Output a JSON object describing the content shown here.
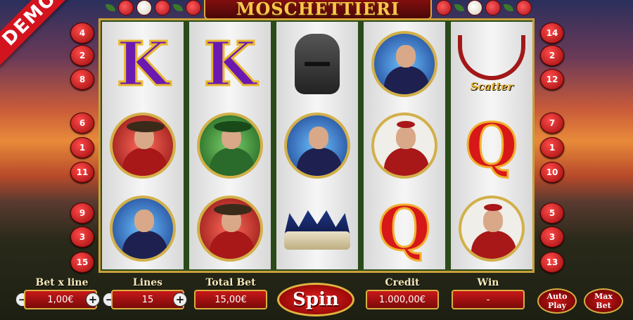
{
  "demo_label": "DEMO",
  "title": "MOSCHETTIERI",
  "left_line_numbers": [
    "4",
    "2",
    "8",
    "6",
    "1",
    "11",
    "9",
    "3",
    "15"
  ],
  "right_line_numbers": [
    "14",
    "2",
    "12",
    "7",
    "1",
    "10",
    "5",
    "3",
    "13"
  ],
  "scatter_label": "Scatter",
  "controls": {
    "bet_label": "Bet x line",
    "bet_value": "1,00€",
    "lines_label": "Lines",
    "lines_value": "15",
    "total_label": "Total Bet",
    "total_value": "15,00€",
    "spin_label": "Spin",
    "credit_label": "Credit",
    "credit_value": "1.000,00€",
    "win_label": "Win",
    "win_value": "-",
    "auto_label_1": "Auto",
    "auto_label_2": "Play",
    "max_label_1": "Max",
    "max_label_2": "Bet",
    "minus": "−",
    "plus": "+"
  },
  "reels": [
    [
      "king-symbol",
      "musketeer-red",
      "musketeer-blue"
    ],
    [
      "king-symbol",
      "musketeer-green",
      "musketeer-red"
    ],
    [
      "iron-mask-symbol",
      "musketeer-blue",
      "crown-symbol"
    ],
    [
      "musketeer-blue",
      "cardinal-symbol",
      "queen-symbol"
    ],
    [
      "scatter-necklace",
      "queen-symbol",
      "cardinal-symbol"
    ]
  ],
  "colors": {
    "accent": "#d9b040",
    "button_red": "#c81818",
    "king_purple": "#6a1ab0"
  }
}
